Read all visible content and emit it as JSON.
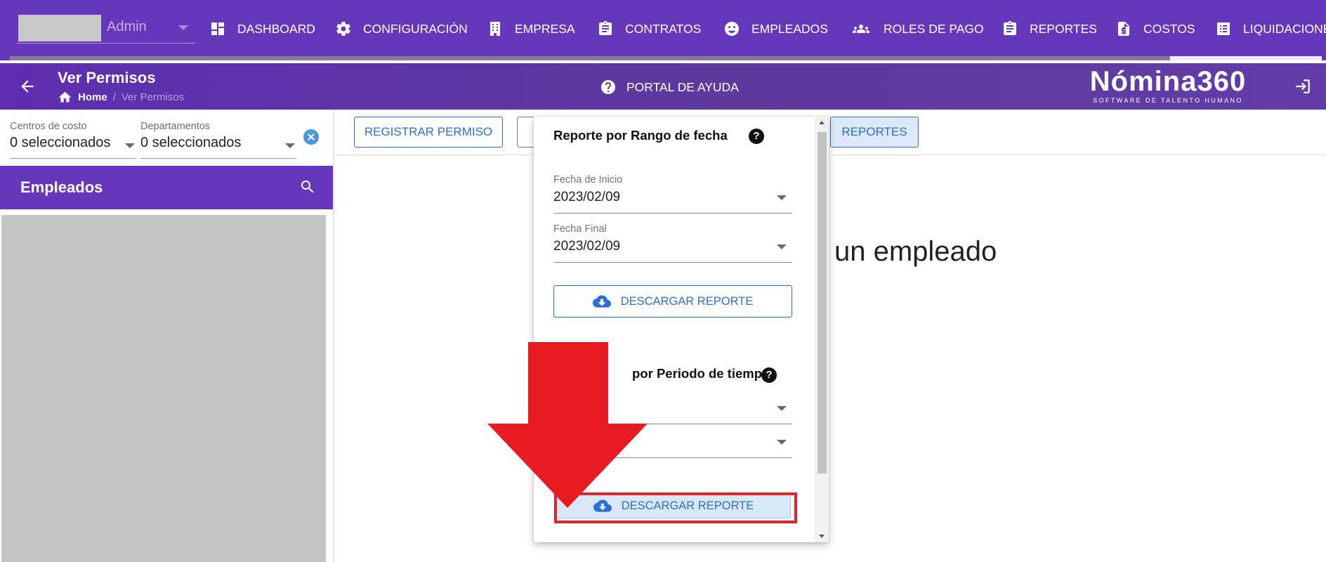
{
  "topnav": {
    "user_label": "Admin",
    "items": [
      {
        "label": "DASHBOARD",
        "icon": "dashboard-icon"
      },
      {
        "label": "CONFIGURACIÓN",
        "icon": "gear-icon"
      },
      {
        "label": "EMPRESA",
        "icon": "building-icon"
      },
      {
        "label": "CONTRATOS",
        "icon": "clipboard-icon"
      },
      {
        "label": "EMPLEADOS",
        "icon": "face-icon"
      },
      {
        "label": "ROLES DE PAGO",
        "icon": "group-icon"
      },
      {
        "label": "REPORTES",
        "icon": "clipboard-icon"
      },
      {
        "label": "COSTOS",
        "icon": "invoice-dollar-icon"
      },
      {
        "label": "LIQUIDACIONE",
        "icon": "list-icon"
      }
    ]
  },
  "subheader": {
    "title": "Ver Permisos",
    "breadcrumb_home": "Home",
    "breadcrumb_sep": "/",
    "breadcrumb_current": "Ver Permisos",
    "help_label": "PORTAL DE AYUDA",
    "brand_name": "Nómina360",
    "brand_tagline": "SOFTWARE DE TALENTO HUMANO"
  },
  "filters": {
    "cost_centers_label": "Centros de costo",
    "cost_centers_value": "0 seleccionados",
    "departments_label": "Departamentos",
    "departments_value": "0 seleccionados"
  },
  "employees": {
    "title": "Empleados"
  },
  "toolbar": {
    "register_label": "REGISTRAR PERMISO",
    "reports_label": "REPORTES"
  },
  "main": {
    "message": "un empleado"
  },
  "report_panel": {
    "range_title": "Reporte por Rango de fecha",
    "start_label": "Fecha de Inicio",
    "start_value": "2023/02/09",
    "end_label": "Fecha Final",
    "end_value": "2023/02/09",
    "download_label": "DESCARGAR REPORTE",
    "period_title": "por Periodo de tiempo",
    "download_label_2": "DESCARGAR REPORTE"
  },
  "colors": {
    "nav_purple": "#6737bb",
    "accent_blue": "#2c6fd3",
    "highlight_red": "#e8202a"
  }
}
